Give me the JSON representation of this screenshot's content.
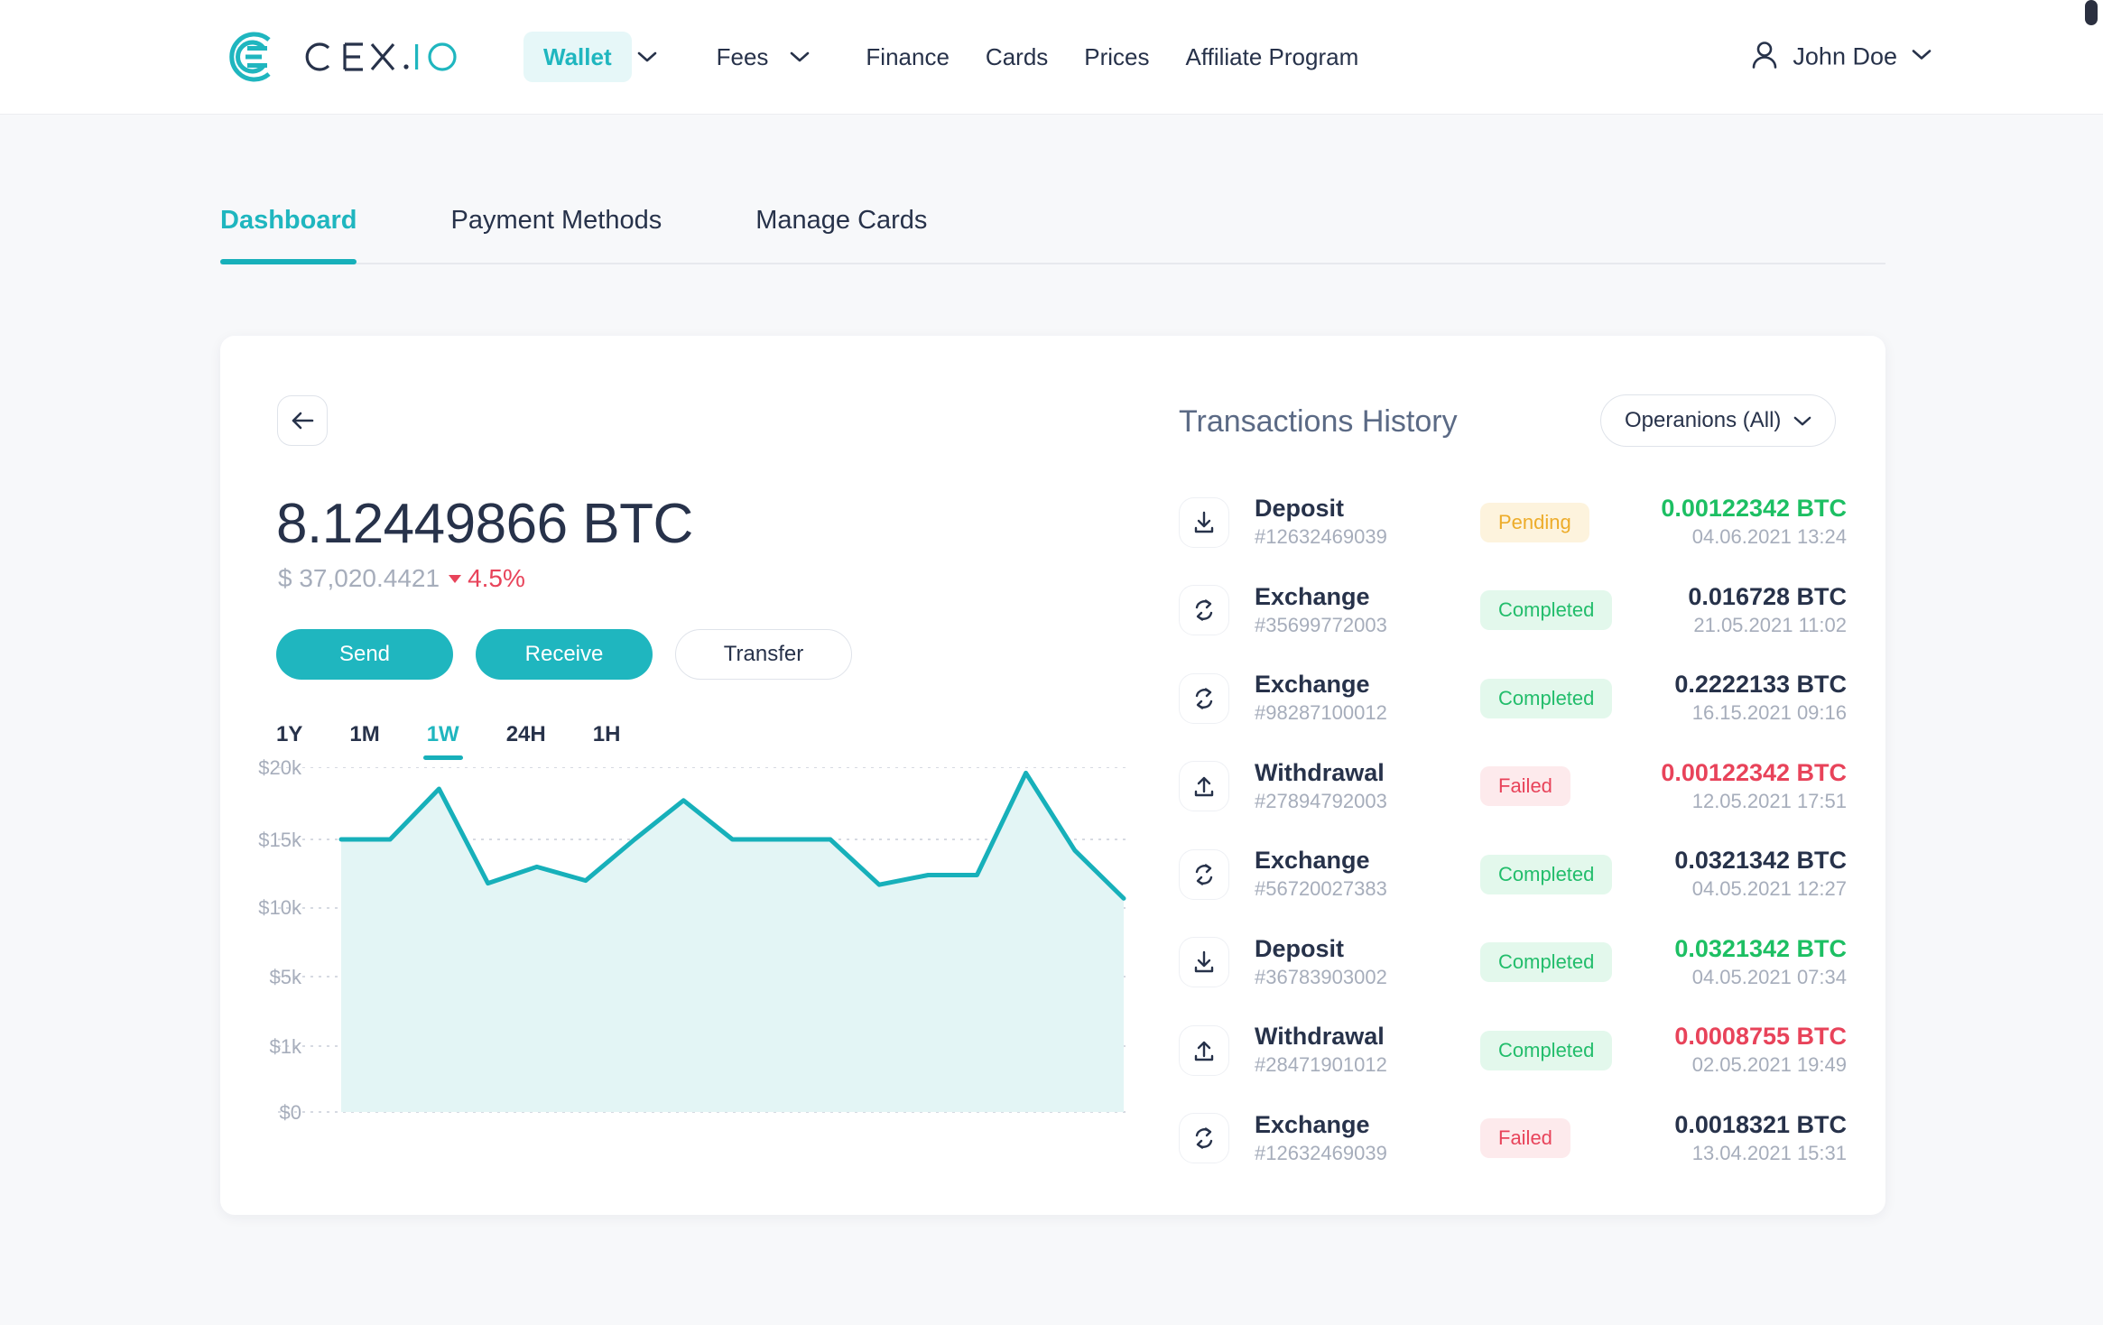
{
  "brand": {
    "name": "CEX.IO"
  },
  "nav": {
    "items": [
      {
        "label": "Wallet",
        "active": true,
        "caret": true
      },
      {
        "label": "Fees",
        "active": false,
        "caret": true
      },
      {
        "label": "Finance",
        "active": false,
        "caret": false
      },
      {
        "label": "Cards",
        "active": false,
        "caret": false
      },
      {
        "label": "Prices",
        "active": false,
        "caret": false
      },
      {
        "label": "Affiliate Program",
        "active": false,
        "caret": false
      }
    ],
    "user": {
      "name": "John Doe"
    }
  },
  "tabs": [
    {
      "label": "Dashboard",
      "active": true
    },
    {
      "label": "Payment Methods",
      "active": false
    },
    {
      "label": "Manage Cards",
      "active": false
    }
  ],
  "wallet": {
    "balance": "8.12449866 BTC",
    "fiat_value": "$ 37,020.4421",
    "change": "4.5%",
    "change_direction": "down",
    "buttons": {
      "send": "Send",
      "receive": "Receive",
      "transfer": "Transfer"
    },
    "ranges": [
      {
        "label": "1Y",
        "active": false
      },
      {
        "label": "1M",
        "active": false
      },
      {
        "label": "1W",
        "active": true
      },
      {
        "label": "24H",
        "active": false
      },
      {
        "label": "1H",
        "active": false
      }
    ]
  },
  "chart_data": {
    "type": "area",
    "title": "",
    "xlabel": "",
    "ylabel": "",
    "ytick_labels": [
      "$20k",
      "$15k",
      "$10k",
      "$5k",
      "$1k",
      "$0"
    ],
    "ytick_values": [
      20000,
      15000,
      10000,
      5000,
      1000,
      0
    ],
    "ylim": [
      0,
      20000
    ],
    "grid": true,
    "legend": "none",
    "line_color": "#17b0ba",
    "fill_color": "#e3f5f5",
    "x": [
      0,
      1,
      2,
      3,
      4,
      5,
      6,
      7,
      8,
      9,
      10,
      11,
      12,
      13,
      14,
      15,
      16
    ],
    "values": [
      15000,
      15000,
      18500,
      11800,
      13000,
      12000,
      15000,
      17700,
      15000,
      15000,
      15000,
      11700,
      12400,
      12400,
      19600,
      14200,
      10700
    ]
  },
  "transactions": {
    "title": "Transactions History",
    "filter_label": "Operanions (All)",
    "rows": [
      {
        "icon": "deposit-icon",
        "type": "Deposit",
        "id": "#12632469039",
        "status": "Pending",
        "status_kind": "pending",
        "amount": "0.00122342 BTC",
        "amount_color": "green",
        "date": "04.06.2021 13:24"
      },
      {
        "icon": "exchange-icon",
        "type": "Exchange",
        "id": "#35699772003",
        "status": "Completed",
        "status_kind": "completed",
        "amount": "0.016728 BTC",
        "amount_color": "dark",
        "date": "21.05.2021 11:02"
      },
      {
        "icon": "exchange-icon",
        "type": "Exchange",
        "id": "#98287100012",
        "status": "Completed",
        "status_kind": "completed",
        "amount": "0.2222133 BTC",
        "amount_color": "dark",
        "date": "16.15.2021 09:16"
      },
      {
        "icon": "withdrawal-icon",
        "type": "Withdrawal",
        "id": "#27894792003",
        "status": "Failed",
        "status_kind": "failed",
        "amount": "0.00122342 BTC",
        "amount_color": "red",
        "date": "12.05.2021 17:51"
      },
      {
        "icon": "exchange-icon",
        "type": "Exchange",
        "id": "#56720027383",
        "status": "Completed",
        "status_kind": "completed",
        "amount": "0.0321342 BTC",
        "amount_color": "dark",
        "date": "04.05.2021 12:27"
      },
      {
        "icon": "deposit-icon",
        "type": "Deposit",
        "id": "#36783903002",
        "status": "Completed",
        "status_kind": "completed",
        "amount": "0.0321342 BTC",
        "amount_color": "green",
        "date": "04.05.2021 07:34"
      },
      {
        "icon": "withdrawal-icon",
        "type": "Withdrawal",
        "id": "#28471901012",
        "status": "Completed",
        "status_kind": "completed",
        "amount": "0.0008755 BTC",
        "amount_color": "red",
        "date": "02.05.2021 19:49"
      },
      {
        "icon": "exchange-icon",
        "type": "Exchange",
        "id": "#12632469039",
        "status": "Failed",
        "status_kind": "failed",
        "amount": "0.0018321 BTC",
        "amount_color": "dark",
        "date": "13.04.2021 15:31"
      }
    ]
  },
  "colors": {
    "accent": "#1fb6bf",
    "accent_dark": "#17b0ba",
    "text": "#27324a",
    "muted": "#a6adbb",
    "green": "#1dbf63",
    "red": "#e8435a",
    "amber": "#edac2a",
    "page_bg": "#f7f8fa"
  }
}
